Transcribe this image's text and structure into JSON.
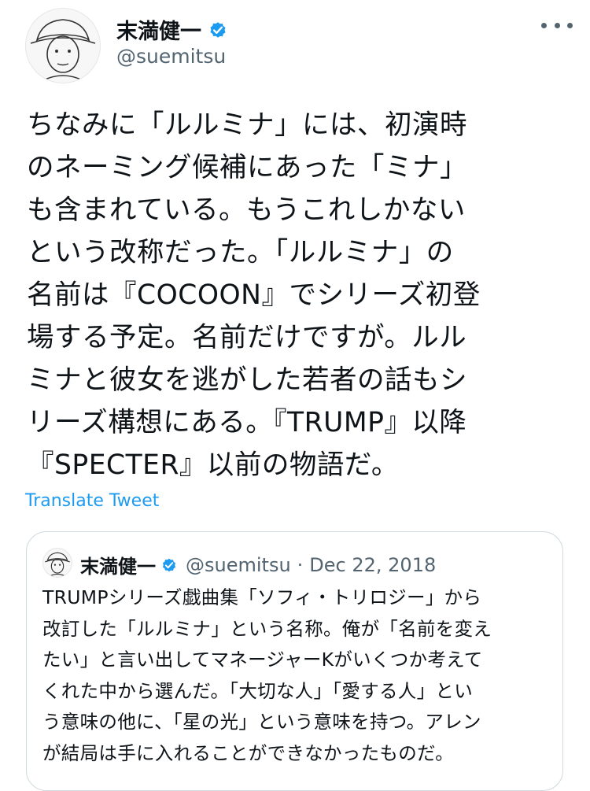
{
  "author": {
    "display_name": "末満健一",
    "handle": "@suemitsu"
  },
  "tweet": {
    "lines": [
      "ちなみに「ルルミナ」には、初演時",
      "のネーミング候補にあった「ミナ」",
      "も含まれている。もうこれしかない",
      "という改称だった。「ルルミナ」の",
      "名前は『COCOON』でシリーズ初登",
      "場する予定。名前だけですが。ルル",
      "ミナと彼女を逃がした若者の話もシ",
      "リーズ構想にある。『TRUMP』以降",
      "『SPECTER』以前の物語だ。"
    ],
    "translate_label": "Translate Tweet"
  },
  "quoted": {
    "display_name": "末満健一",
    "handle": "@suemitsu",
    "separator": "·",
    "date": "Dec 22, 2018",
    "lines": [
      "TRUMPシリーズ戯曲集「ソフィ・トリロジー」から",
      "改訂した「ルルミナ」という名称。俺が「名前を変え",
      "たい」と言い出してマネージャーKがいくつか考えて",
      "くれた中から選んだ。「大切な人」「愛する人」とい",
      "う意味の他に、「星の光」という意味を持つ。アレン",
      "が結局は手に入れることができなかったものだ。"
    ]
  },
  "icons": {
    "verified": "verified-badge-icon",
    "more": "more-options-icon"
  },
  "colors": {
    "accent": "#1d9bf0",
    "text": "#0f1419",
    "secondary": "#536471",
    "border": "#cfd9de"
  }
}
